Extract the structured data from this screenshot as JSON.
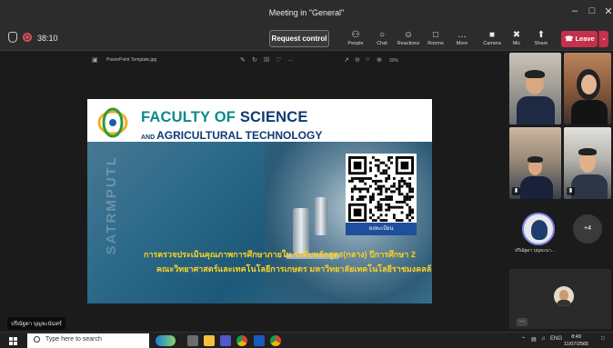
{
  "window": {
    "title": "Meeting in \"General\""
  },
  "meeting": {
    "timer": "38:10",
    "request_control": "Request control",
    "toolbar": [
      {
        "label": "People",
        "icon": "people-icon",
        "glyph": "&#x2687;"
      },
      {
        "label": "Chat",
        "icon": "chat-icon",
        "glyph": "&#x25CB;"
      },
      {
        "label": "Reactions",
        "icon": "reactions-icon",
        "glyph": "&#x263A;"
      },
      {
        "label": "Rooms",
        "icon": "rooms-icon",
        "glyph": "&#x25A1;"
      },
      {
        "label": "More",
        "icon": "more-icon",
        "glyph": "&#x2026;"
      },
      {
        "label": "Camera",
        "icon": "camera-off-icon",
        "glyph": "&#x25A0;"
      },
      {
        "label": "Mic",
        "icon": "mic-off-icon",
        "glyph": "&#x2716;"
      },
      {
        "label": "Share",
        "icon": "share-icon",
        "glyph": "&#x2B06;"
      }
    ],
    "leave": "Leave"
  },
  "slide_toolbar": {
    "filename": "PowerPoint Template.jpg",
    "zoom": "30%"
  },
  "slide": {
    "faculty_line1_a": "FACULTY OF ",
    "faculty_line1_b": "SCIENCE",
    "faculty_line2_a": "AND ",
    "faculty_line2_b": "AGRICULTURAL TECHNOLOGY",
    "vertical_text": "SATRMPUTL",
    "qr_label": "ลงทะเบียน",
    "thai_line1": "การตรวจประเมินคุณภาพการศึกษาภายใน ระดับหลักสูตร(กลาง) ปีการศึกษา 2",
    "thai_line2": "คณะวิทยาศาสตร์และเทคโนโลยีการเกษตร มหาวิทยาลัยเทคโนโลยีราชมงคลล้"
  },
  "presenter_name": "ปรีณัฐดา บุญจะนันทร์",
  "roster": {
    "avatar_label": "ปรีณัฐดา บุญจะนา...",
    "more_count": "+4"
  },
  "taskbar": {
    "search_placeholder": "Type here to search",
    "language": "ENG",
    "time": "8:49",
    "date": "11/07/2565"
  }
}
